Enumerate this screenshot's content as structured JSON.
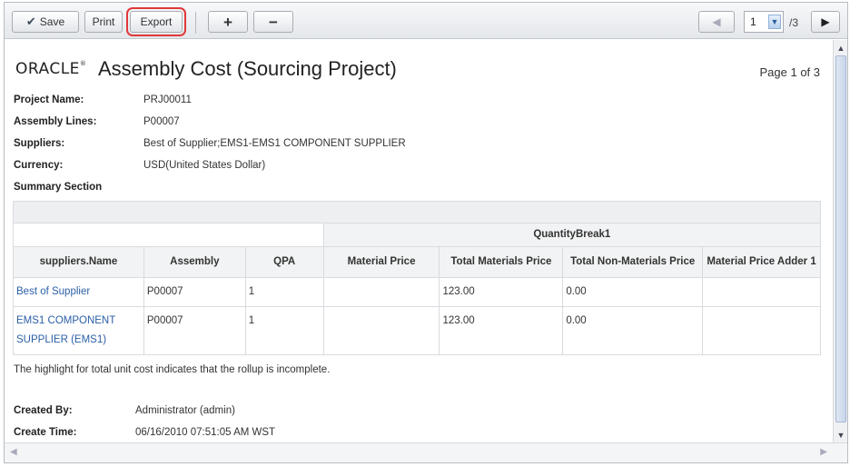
{
  "toolbar": {
    "save_label": "Save",
    "print_label": "Print",
    "export_label": "Export",
    "add_label": "+",
    "remove_label": "−"
  },
  "pager": {
    "current_page": "1",
    "total": "/3"
  },
  "report": {
    "logo": "ORACLE",
    "title": "Assembly Cost (Sourcing Project)",
    "page_info": "Page 1 of 3"
  },
  "meta": [
    {
      "label": "Project Name:",
      "value": "PRJ00011"
    },
    {
      "label": "Assembly Lines:",
      "value": "P00007"
    },
    {
      "label": "Suppliers:",
      "value": "Best of Supplier;EMS1-EMS1 COMPONENT SUPPLIER"
    },
    {
      "label": "Currency:",
      "value": "USD(United States Dollar)"
    }
  ],
  "summary_title": "Summary Section",
  "table": {
    "group_header": "QuantityBreak1",
    "columns": [
      "suppliers.Name",
      "Assembly",
      "QPA",
      "Material Price",
      "Total Materials Price",
      "Total Non-Materials Price",
      "Material Price Adder 1"
    ],
    "rows": [
      [
        "Best of Supplier",
        "P00007",
        "1",
        "",
        "123.00",
        "0.00",
        ""
      ],
      [
        "EMS1 COMPONENT SUPPLIER (EMS1)",
        "P00007",
        "1",
        "",
        "123.00",
        "0.00",
        ""
      ]
    ]
  },
  "note": "The highlight for total unit cost indicates that the rollup is incomplete.",
  "footer": [
    {
      "label": "Created By:",
      "value": "Administrator (admin)"
    },
    {
      "label": "Create Time:",
      "value": "06/16/2010 07:51:05 AM WST"
    }
  ]
}
